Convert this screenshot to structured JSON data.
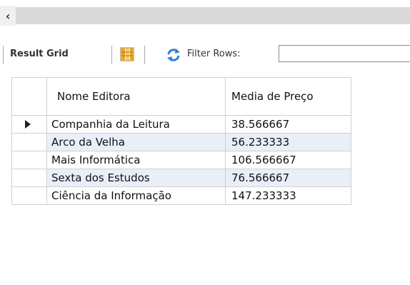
{
  "toolbar": {
    "result_grid_label": "Result Grid",
    "filter_label": "Filter Rows:",
    "filter_value": ""
  },
  "grid": {
    "columns": [
      "Nome Editora",
      "Media de Preço"
    ],
    "rows": [
      {
        "nome": "Companhia da Leitura",
        "media": "38.566667"
      },
      {
        "nome": "Arco da Velha",
        "media": "56.233333"
      },
      {
        "nome": "Mais Informática",
        "media": "106.566667"
      },
      {
        "nome": "Sexta dos Estudos",
        "media": "76.566667"
      },
      {
        "nome": "Ciência da Informação",
        "media": "147.233333"
      }
    ]
  },
  "icons": {
    "scroll_left": "chevron-left-icon",
    "grid_view": "grid-layout-icon",
    "refresh": "refresh-icon",
    "current_row": "row-pointer-icon"
  },
  "colors": {
    "alt_row": "#e9eff9",
    "grid_icon_orange": "#f0a020",
    "refresh_blue": "#2f7fd6"
  }
}
